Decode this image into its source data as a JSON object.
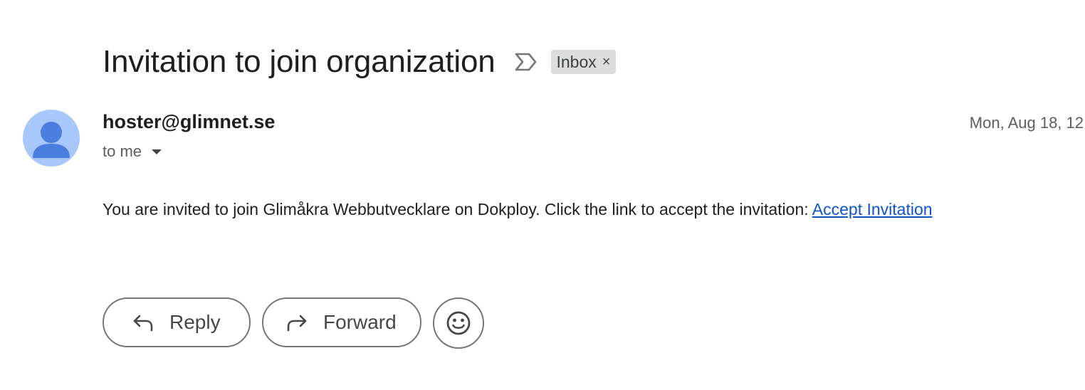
{
  "email": {
    "subject": "Invitation to join organization",
    "label": "Inbox",
    "label_remove": "×",
    "sender": "hoster@glimnet.se",
    "recipient": "to me",
    "date": "Mon, Aug 18, 12",
    "body_text": "You are invited to join Glimåkra Webbutvecklare on Dokploy. Click the link to accept the invitation: ",
    "link_text": "Accept Invitation"
  },
  "actions": {
    "reply_label": "Reply",
    "forward_label": "Forward"
  },
  "icons": {
    "importance": "importance-marker-icon",
    "avatar": "person-avatar-icon",
    "caret": "caret-down-icon",
    "reply": "reply-arrow-icon",
    "forward": "forward-arrow-icon",
    "emoji": "smiley-emoji-icon"
  },
  "colors": {
    "avatar_bg": "#a8c7fa",
    "avatar_fg": "#4a7fe0",
    "link": "#1155cc",
    "chip_bg": "#dddddd"
  }
}
